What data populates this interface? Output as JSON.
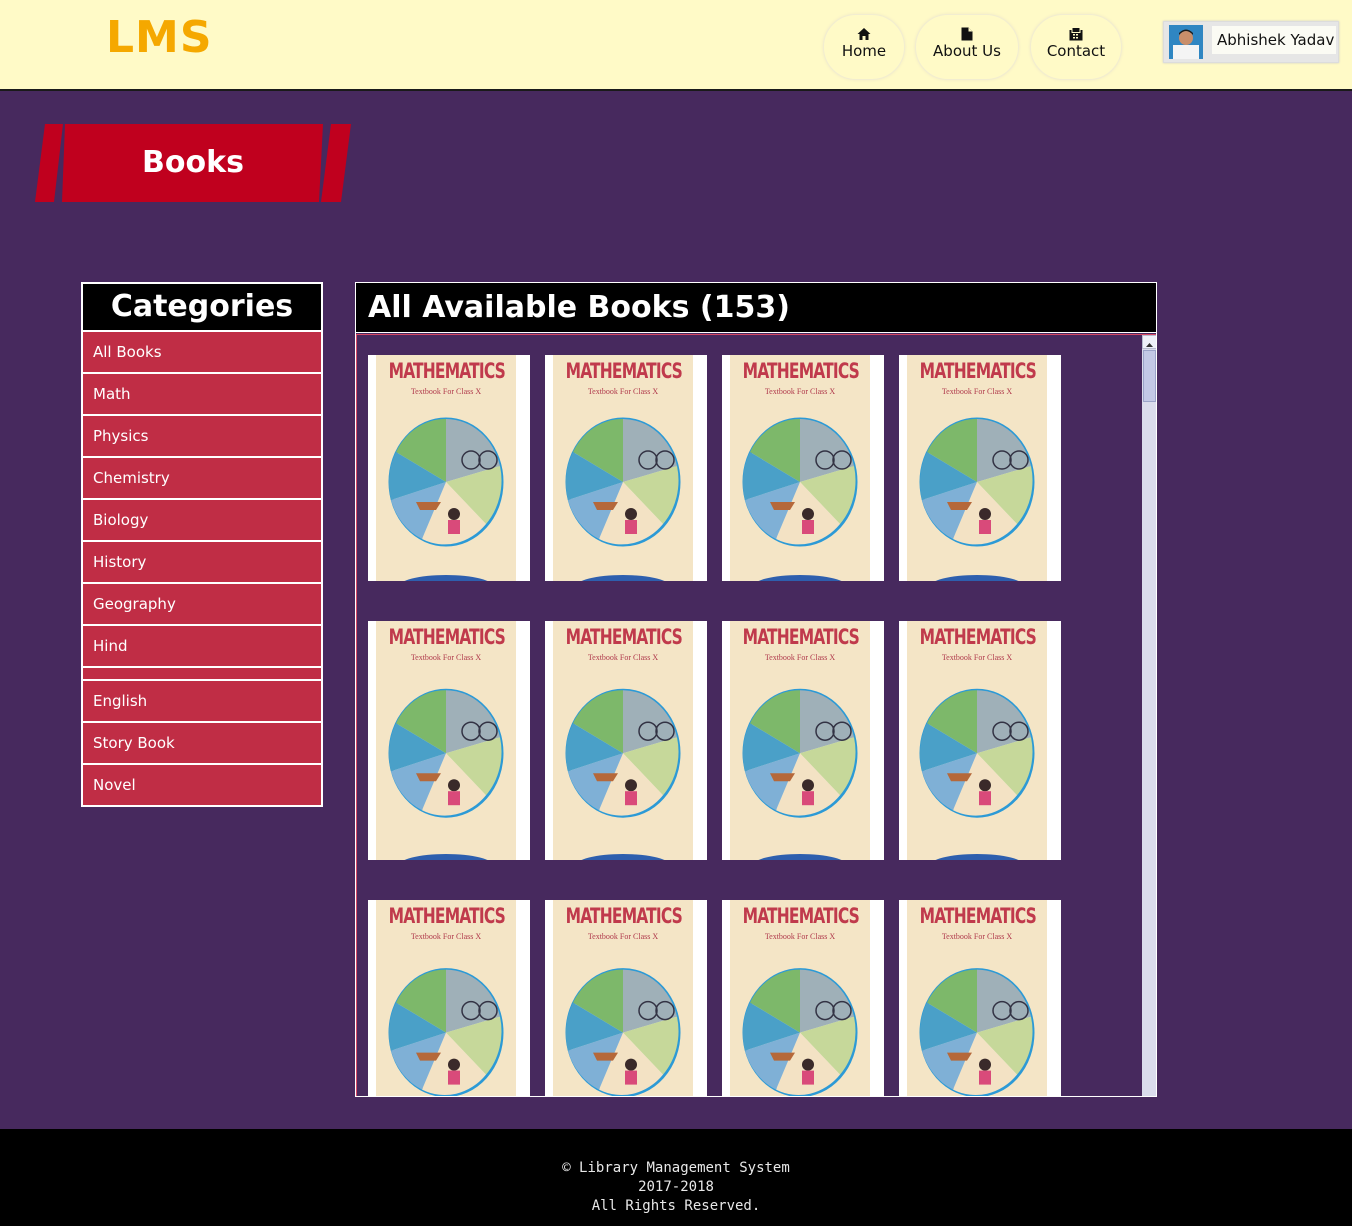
{
  "header": {
    "logo": "LMS",
    "nav": [
      {
        "label": "Home",
        "icon": "home-icon"
      },
      {
        "label": "About Us",
        "icon": "file-icon"
      },
      {
        "label": "Contact",
        "icon": "fax-icon"
      }
    ],
    "user": {
      "name": "Abhishek Yadav"
    }
  },
  "banner": {
    "title": "Books",
    "color": "#c0001e"
  },
  "categories": {
    "title": "Categories",
    "items": [
      "All Books",
      "Math",
      "Physics",
      "Chemistry",
      "Biology",
      "History",
      "Geography",
      "Hind",
      "English",
      "Story Book",
      "Novel"
    ]
  },
  "books": {
    "title": "All Available Books (153)",
    "cover_title": "MATHEMATICS",
    "cover_subtitle": "Textbook For Class X"
  },
  "footer": {
    "line1": "© Library Management System",
    "line2": "2017-2018",
    "line3": "All Rights Reserved."
  },
  "colors": {
    "page_bg": "#47295e",
    "header_bg": "#fffac7",
    "logo": "#f5a800",
    "category_item": "#c02d45"
  }
}
